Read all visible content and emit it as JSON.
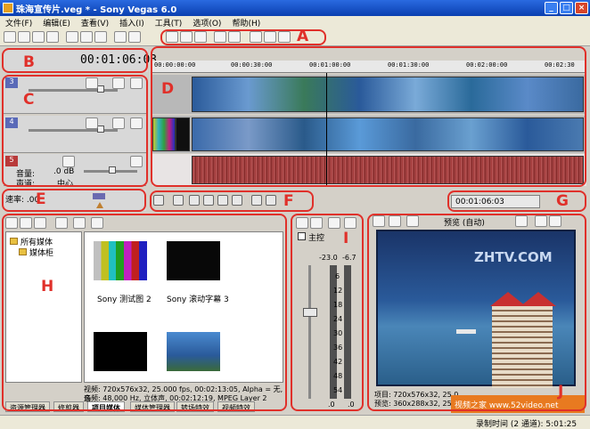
{
  "window": {
    "title": "珠海宣传片.veg * - Sony Vegas 6.0",
    "btn_min": "_",
    "btn_max": "□",
    "btn_close": "×"
  },
  "menu": [
    "文件(F)",
    "编辑(E)",
    "查看(V)",
    "插入(I)",
    "工具(T)",
    "选项(O)",
    "帮助(H)"
  ],
  "annotations": {
    "A": "A",
    "B": "B",
    "C": "C",
    "D": "D",
    "E": "E",
    "F": "F",
    "G": "G",
    "H": "H",
    "I": "I",
    "J": "J"
  },
  "timeline": {
    "timecode": "00:01:06:03",
    "ruler_ticks": [
      "00:00:00:00",
      "00:00:30:00",
      "00:01:00:00",
      "00:01:30:00",
      "00:02:00:00",
      "00:02:30"
    ],
    "tracks": [
      {
        "number": "3"
      },
      {
        "number": "4"
      },
      {
        "number": "5",
        "volume_label": "音量:",
        "volume_value": ".0 dB",
        "pan_label": "声道:",
        "pan_value": "中心"
      }
    ],
    "rate_label": "速率: .00",
    "cursor_timecode": "00:01:06:03"
  },
  "media": {
    "tree": [
      "所有媒体",
      "媒体柜"
    ],
    "items": [
      {
        "name": "Sony 测试图 2"
      },
      {
        "name": "Sony 滚动字幕 3"
      },
      {
        "name": ""
      },
      {
        "name": ""
      }
    ],
    "info_line1": "视频: 720x576x32, 25.000 fps, 00:02:13:05, Alpha = 无, 场",
    "info_line2": "音频: 48,000 Hz, 立体声, 00:02:12:19, MPEG Layer 2",
    "tabs": [
      "资源管理器",
      "修剪器",
      "项目媒体",
      "媒体管理器",
      "转场特效",
      "视频特效"
    ],
    "active_tab": 2
  },
  "mixer": {
    "label": "主控",
    "level_left": "-23.0",
    "level_right": "-6.7",
    "scale": [
      "6",
      "12",
      "18",
      "24",
      "30",
      "36",
      "42",
      "48",
      "54"
    ],
    "bottom_left": ".0",
    "bottom_right": ".0"
  },
  "preview": {
    "mode": "预览 (自动)",
    "watermark": "ZHTV.COM",
    "info_line1": "项目: 720x576x32, 25.0",
    "info_line2": "预览: 360x288x32, 25.0",
    "site_badge": "视频之家 www.52video.net"
  },
  "status": {
    "record_time": "录制时间 (2 通道): 5:01:25"
  },
  "colors": {
    "annotation": "#e0302a",
    "titlebar": "#0a3fb0",
    "preview_bg": "#1f3e7a",
    "track_video": "#5a6ab8",
    "track_audio": "#b83a3a"
  }
}
